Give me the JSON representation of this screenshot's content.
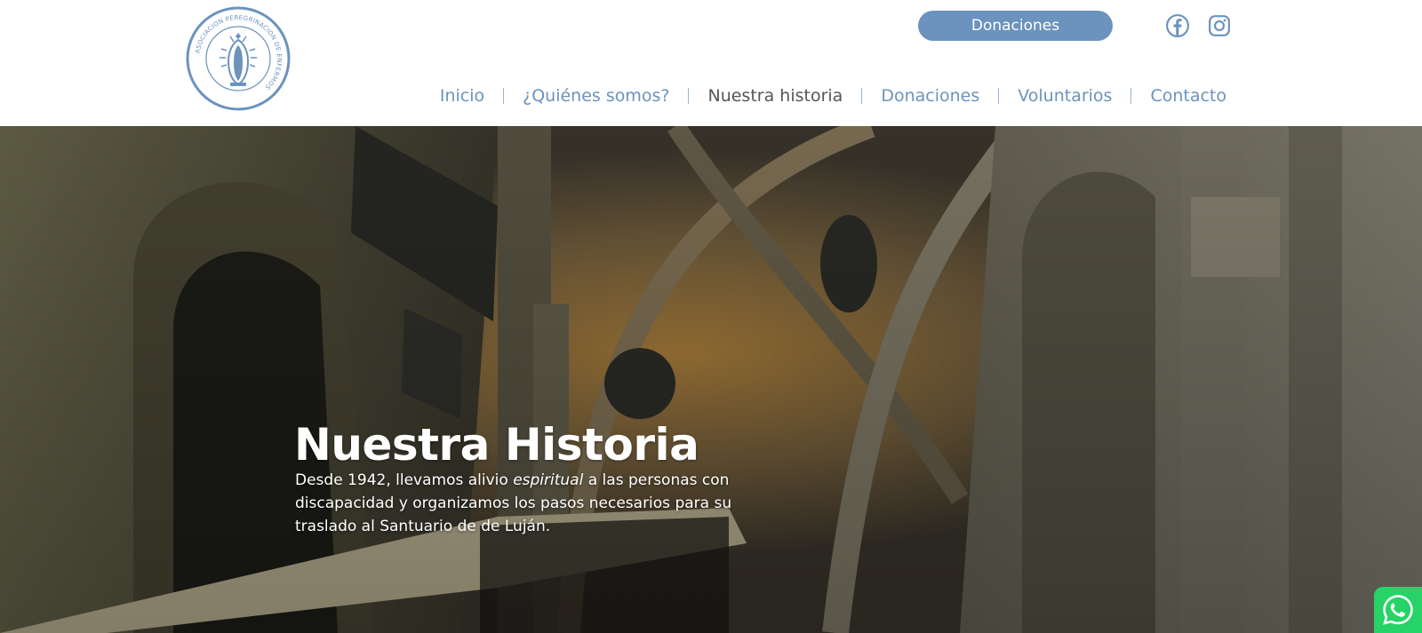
{
  "header": {
    "logo_ring_text": "ASOCIACION PEREGRINACION DE ENFERMOS",
    "donate_button": "Donaciones",
    "social": {
      "facebook_icon": "facebook-icon",
      "instagram_icon": "instagram-icon"
    }
  },
  "nav": {
    "items": [
      {
        "label": "Inicio"
      },
      {
        "label": "¿Quiénes somos?"
      },
      {
        "label": "Nuestra historia"
      },
      {
        "label": "Donaciones"
      },
      {
        "label": "Voluntarios"
      },
      {
        "label": "Contacto"
      }
    ],
    "active_index": 2
  },
  "hero": {
    "title": "Nuestra Historia",
    "text_before": "Desde 1942, llevamos alivio ",
    "text_italic": "espiritual",
    "text_after": " a las personas con discapacidad y organizamos los pasos necesarios para su traslado al Santuario de de Luján."
  },
  "colors": {
    "accent": "#6b93bd",
    "active_nav": "#555555",
    "whatsapp": "#25d366"
  },
  "whatsapp_icon": "whatsapp-icon"
}
